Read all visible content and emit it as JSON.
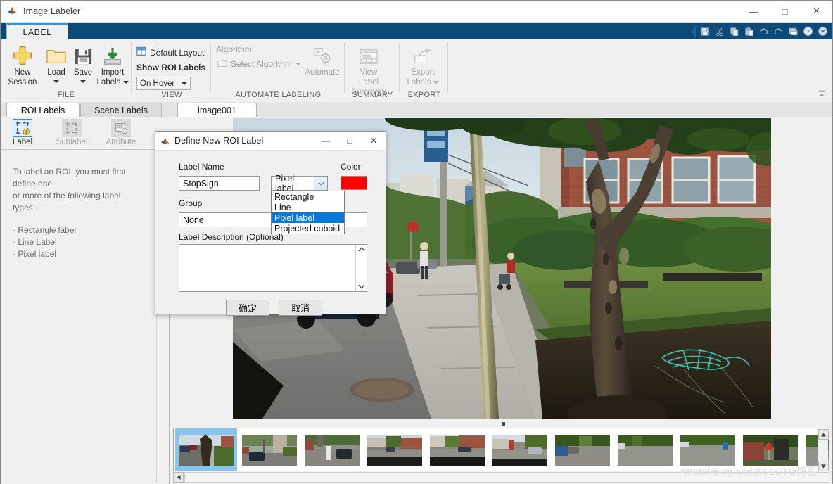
{
  "window": {
    "title": "Image Labeler",
    "minimize": "—",
    "maximize": "□",
    "close": "✕"
  },
  "ribbon": {
    "tab": "LABEL",
    "quick_access": [
      "save-icon",
      "cut-icon",
      "copy-icon",
      "paste-icon",
      "undo-icon",
      "redo-icon",
      "layout-icon",
      "help-icon",
      "more-icon"
    ],
    "groups": [
      {
        "title": "FILE",
        "buttons": [
          {
            "label1": "New",
            "label2": "Session",
            "icon": "plus-icon",
            "enabled": true,
            "dropdown": false
          },
          {
            "label1": "Load",
            "label2": "",
            "icon": "folder-icon",
            "enabled": true,
            "dropdown": true
          },
          {
            "label1": "Save",
            "label2": "",
            "icon": "floppy-icon",
            "enabled": true,
            "dropdown": true
          },
          {
            "label1": "Import",
            "label2": "Labels",
            "icon": "import-icon",
            "enabled": true,
            "dropdown": true
          }
        ]
      },
      {
        "title": "VIEW",
        "default_layout": "Default Layout",
        "show_roi_labels": "Show ROI Labels",
        "on_hover": "On Hover"
      },
      {
        "title": "AUTOMATE LABELING",
        "algorithm_label": "Algorithm:",
        "select_algorithm": "Select Algorithm",
        "automate": "Automate"
      },
      {
        "title": "SUMMARY",
        "view_label_summary_l1": "View Label",
        "view_label_summary_l2": "Summary"
      },
      {
        "title": "EXPORT",
        "export_labels_l1": "Export",
        "export_labels_l2": "Labels"
      }
    ]
  },
  "left_panel": {
    "tabs": [
      {
        "label": "ROI Labels",
        "active": true
      },
      {
        "label": "Scene Labels",
        "active": false
      }
    ],
    "tools": [
      {
        "label": "Label",
        "icon": "label-add-icon",
        "enabled": true
      },
      {
        "label": "Sublabel",
        "icon": "sublabel-icon",
        "enabled": false
      },
      {
        "label": "Attribute",
        "icon": "attribute-icon",
        "enabled": false
      }
    ],
    "hint_line1": "To label an ROI, you must first define one",
    "hint_line2": "or more of the following label types:",
    "hint_items": [
      "- Rectangle label",
      "- Line Label",
      "- Pixel label"
    ]
  },
  "main": {
    "image_tab": "image001",
    "thumbnail_count": 11,
    "selected_thumbnail": 0
  },
  "dialog": {
    "title": "Define New ROI Label",
    "icon": "matlab-icon",
    "minimize": "—",
    "maximize": "□",
    "close": "✕",
    "label_name_caption": "Label Name",
    "label_name_value": "StopSign",
    "color_caption": "Color",
    "color_value": "#fe0000",
    "roi_type_value": "Pixel label",
    "roi_type_options": [
      {
        "label": "Rectangle",
        "selected": false
      },
      {
        "label": "Line",
        "selected": false
      },
      {
        "label": "Pixel label",
        "selected": true
      },
      {
        "label": "Projected cuboid",
        "selected": false
      }
    ],
    "group_caption": "Group",
    "group_value": "None",
    "description_caption": "Label Description (Optional)",
    "description_value": "",
    "ok_button": "确定",
    "cancel_button": "取消"
  },
  "watermark": "https://blog.csd@51CTO博客",
  "colors": {
    "ribbon_tabstrip": "#0e4a78",
    "tab_accent": "#1c9ae8",
    "selection_blue": "#0a78d7",
    "thumb_selected": "#86c5ee",
    "panel_bg": "#f0f0f0"
  }
}
